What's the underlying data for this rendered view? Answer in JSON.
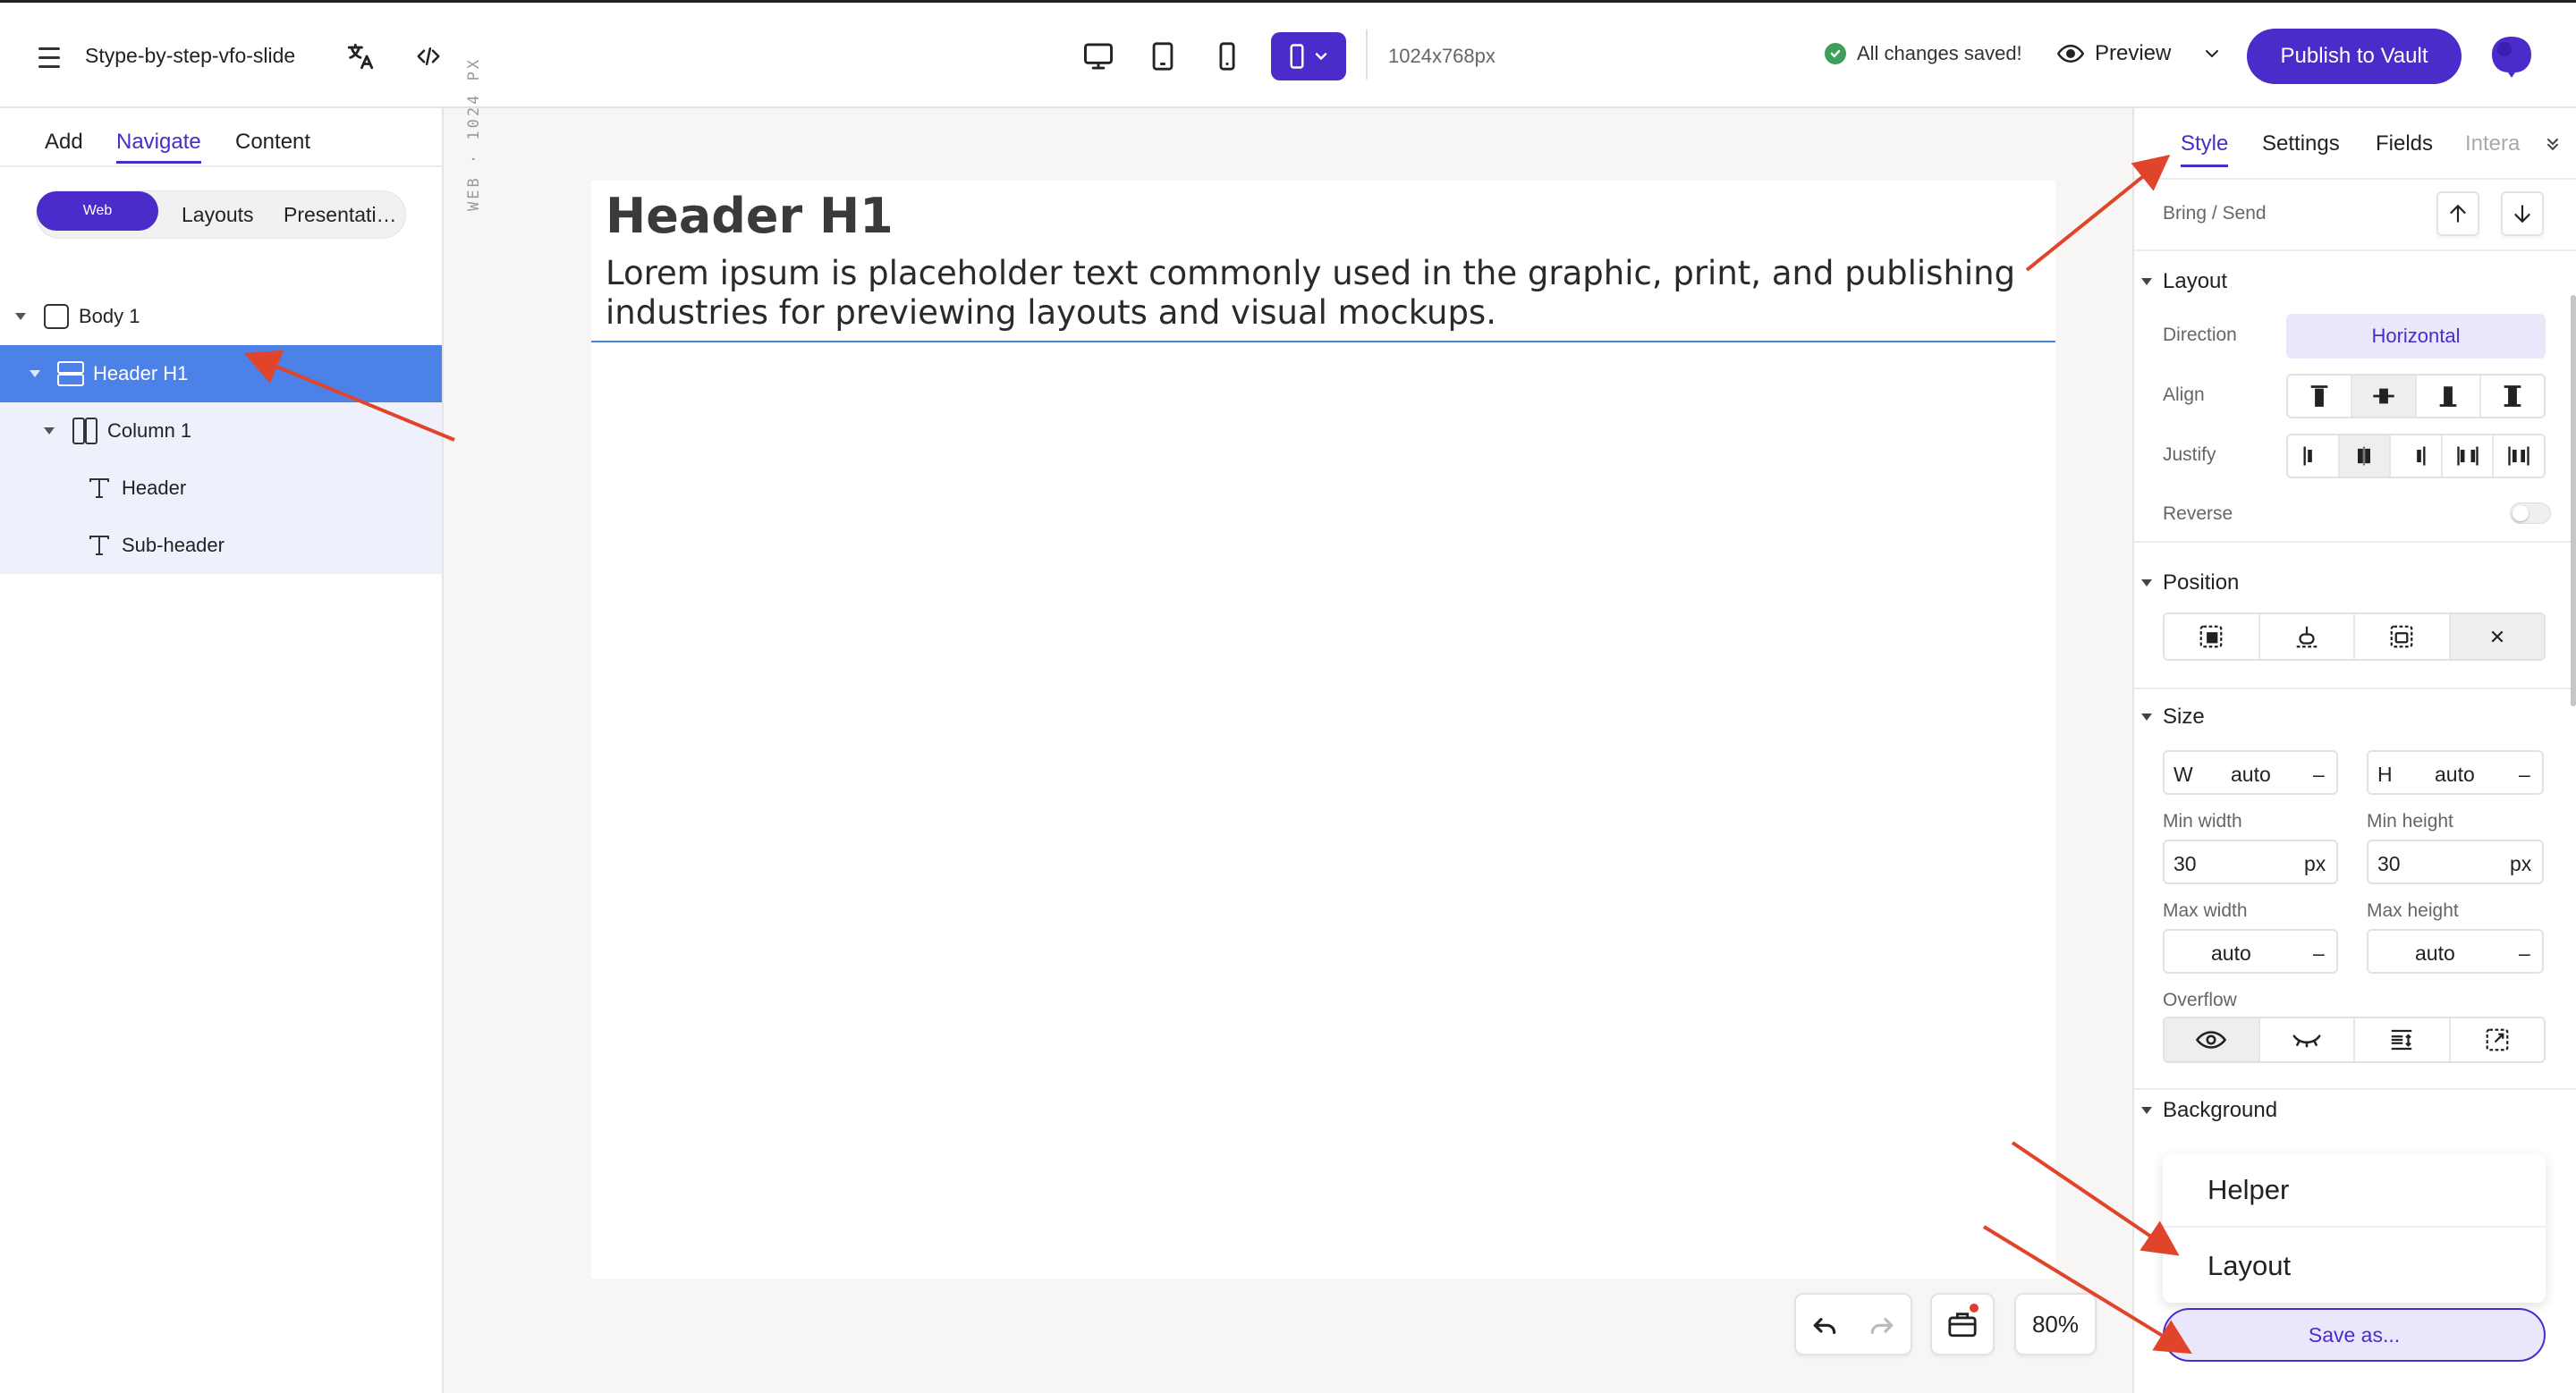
{
  "topbar": {
    "doc_title": "Stype-by-step-vfo-slide",
    "resolution": "1024x768px",
    "save_status": "All changes saved!",
    "preview_label": "Preview",
    "publish_label": "Publish to Vault"
  },
  "left_panel": {
    "tabs": [
      "Add",
      "Navigate",
      "Content"
    ],
    "active_tab": "Navigate",
    "modes": [
      "Web",
      "Layouts",
      "Presentati…"
    ],
    "active_mode": "Web",
    "tree": [
      {
        "label": "Body 1",
        "icon": "square-icon"
      },
      {
        "label": "Header H1",
        "icon": "rows-icon",
        "selected": true
      },
      {
        "label": "Column 1",
        "icon": "columns-icon"
      },
      {
        "label": "Header",
        "icon": "text-icon"
      },
      {
        "label": "Sub-header",
        "icon": "text-icon"
      }
    ]
  },
  "canvas": {
    "ruler_label": "WEB · 1024 PX",
    "heading": "Header H1",
    "paragraph": "Lorem ipsum is placeholder text commonly used in the graphic, print, and publishing industries for previewing layouts and visual mockups.",
    "zoom": "80%"
  },
  "right_panel": {
    "tabs": [
      "Style",
      "Settings",
      "Fields",
      "Intera"
    ],
    "active_tab": "Style",
    "bring_send_label": "Bring / Send",
    "layout": {
      "title": "Layout",
      "direction_label": "Direction",
      "direction_value": "Horizontal",
      "align_label": "Align",
      "justify_label": "Justify",
      "reverse_label": "Reverse",
      "reverse_on": false
    },
    "position": {
      "title": "Position"
    },
    "size": {
      "title": "Size",
      "w_label": "W",
      "w_value": "auto",
      "h_label": "H",
      "h_value": "auto",
      "dash": "–",
      "min_width_label": "Min width",
      "min_width_value": "30",
      "min_width_unit": "px",
      "min_height_label": "Min height",
      "min_height_value": "30",
      "min_height_unit": "px",
      "max_width_label": "Max width",
      "max_width_value": "auto",
      "max_height_label": "Max height",
      "max_height_value": "auto",
      "overflow_label": "Overflow"
    },
    "background": {
      "title": "Background"
    },
    "save_menu": {
      "items": [
        "Helper",
        "Layout"
      ]
    },
    "save_as_label": "Save as..."
  },
  "colors": {
    "accent": "#4b2bc9",
    "selection": "#4c82e8",
    "annotation_arrow": "#e0452c",
    "saved_dot": "#3f9f5a"
  }
}
